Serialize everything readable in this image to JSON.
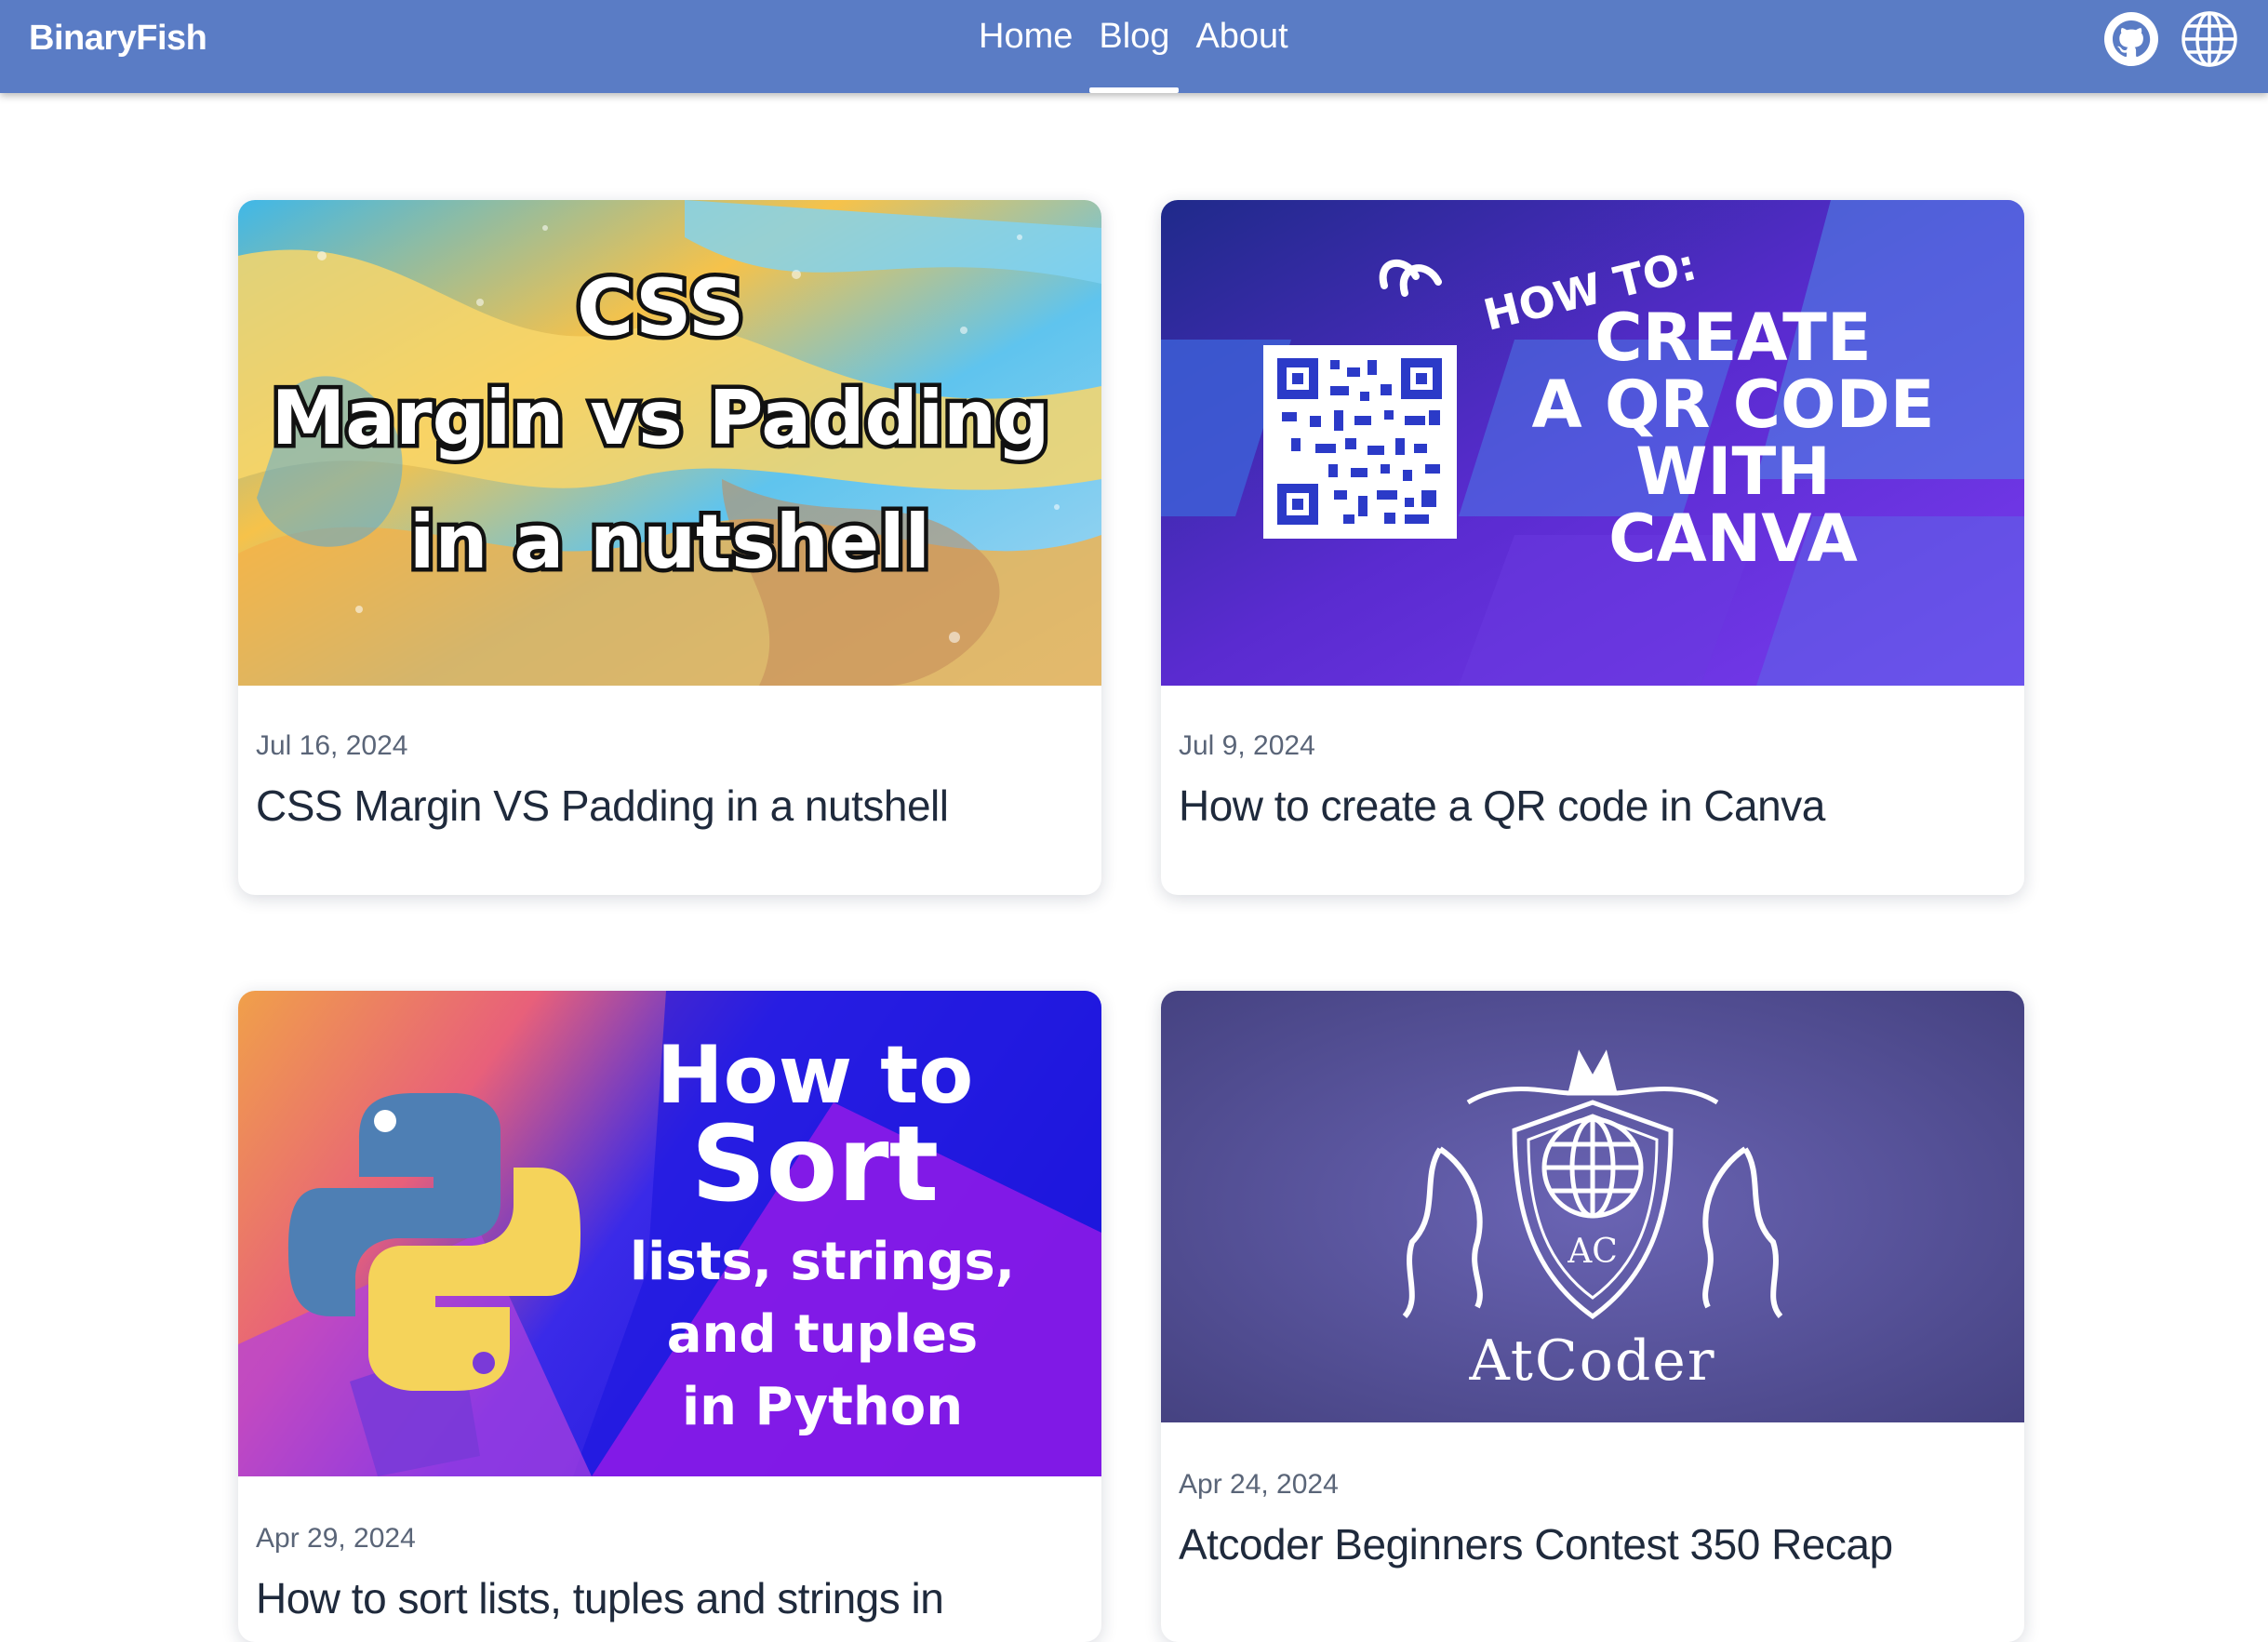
{
  "header": {
    "brand": "BinaryFish",
    "nav": [
      {
        "label": "Home",
        "active": false
      },
      {
        "label": "Blog",
        "active": true
      },
      {
        "label": "About",
        "active": false
      }
    ],
    "icons": [
      "github-icon",
      "globe-icon"
    ],
    "background_color": "#5a7cc5"
  },
  "posts": [
    {
      "date": "Jul 16, 2024",
      "title": "CSS Margin VS Padding in a nutshell",
      "thumbnail": {
        "line1": "CSS",
        "line2": "Margin vs Padding",
        "line3": "in a nutshell"
      }
    },
    {
      "date": "Jul 9, 2024",
      "title": "How to create a QR code in Canva",
      "thumbnail": {
        "kicker": "HOW TO:",
        "line1": "CREATE",
        "line2": "A QR CODE",
        "line3": "WITH",
        "line4": "CANVA"
      }
    },
    {
      "date": "Apr 29, 2024",
      "title": "How to sort lists, tuples and strings in",
      "thumbnail": {
        "line1": "How to",
        "line2": "Sort",
        "line3": "lists, strings,",
        "line4": "and tuples",
        "line5": "in Python"
      }
    },
    {
      "date": "Apr 24, 2024",
      "title": "Atcoder Beginners Contest 350 Recap",
      "thumbnail": {
        "logo_text": "AtCoder"
      }
    }
  ]
}
